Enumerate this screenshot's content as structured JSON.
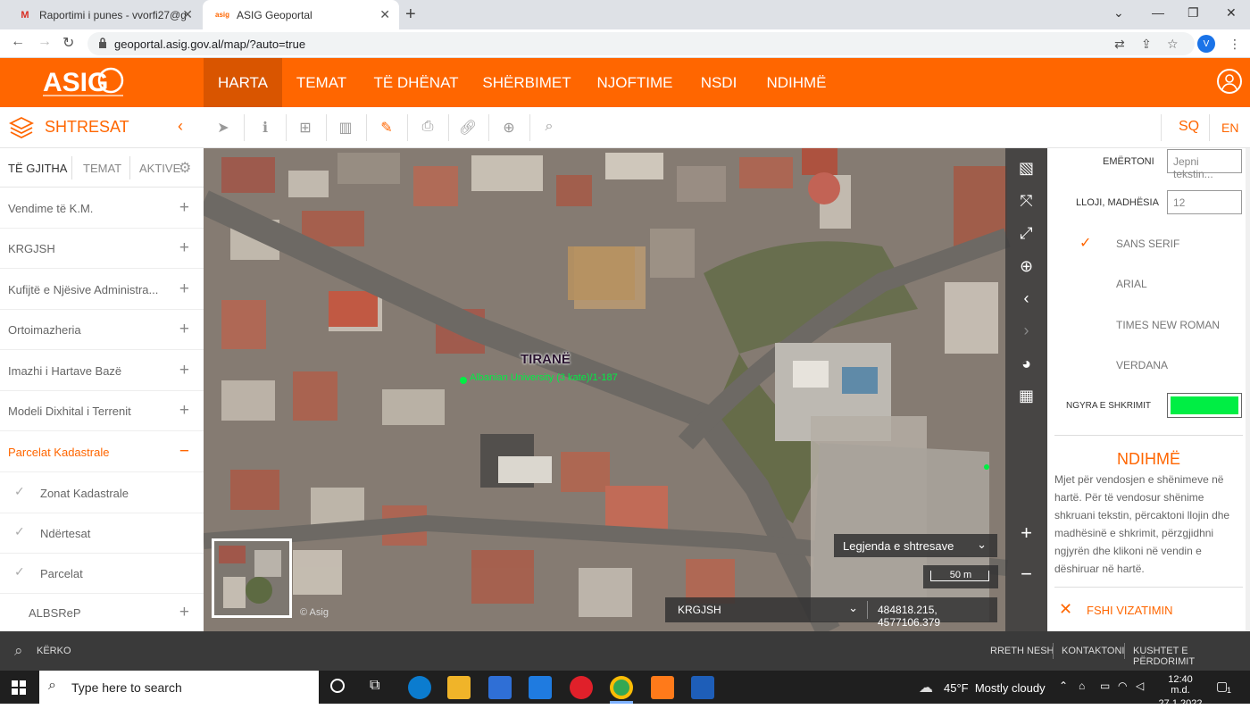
{
  "browser": {
    "tabs": [
      {
        "title": "Raportimi i punes - vvorfi27@gm",
        "icon": "gmail-icon"
      },
      {
        "title": "ASIG Geoportal",
        "icon": "asig-favicon-icon"
      }
    ],
    "url": "geoportal.asig.gov.al/map/?auto=true",
    "profile_initial": "V"
  },
  "header": {
    "logo": "ASIG",
    "menu": [
      "HARTA",
      "TEMAT",
      "TË DHËNAT",
      "SHËRBIMET",
      "NJOFTIME",
      "NSDI",
      "NDIHMË"
    ],
    "active": "HARTA"
  },
  "toolbar": {
    "panel_title": "SHTRESAT",
    "lang": {
      "sq": "SQ",
      "en": "EN"
    }
  },
  "sidebar": {
    "tabs": [
      "TË GJITHA",
      "TEMAT",
      "AKTIVE"
    ],
    "layers": [
      "Vendime të K.M.",
      "KRGJSH",
      "Kufijtë e Njësive Administra...",
      "Ortoimazheria",
      "Imazhi i Hartave Bazë",
      "Modeli Dixhital i Terrenit",
      "Parcelat Kadastrale"
    ],
    "sub_layers": [
      "Zonat Kadastrale",
      "Ndërtesat",
      "Parcelat"
    ],
    "extra_layer": "ALBSReP"
  },
  "map": {
    "city_label": "TIRANË",
    "poi_label": "Albanian University (3 kate)/1-187",
    "legend_label": "Legjenda e shtresave",
    "scale_label": "50 m",
    "projection": "KRGJSH",
    "coordinates": "484818.215, 4577106.379",
    "watermark": "© Asig"
  },
  "drawing_panel": {
    "name_label": "EMËRTONI",
    "name_placeholder": "Jepni tekstin...",
    "size_label": "LLOJI, MADHËSIA",
    "size_value": "12",
    "fonts": [
      "SANS SERIF",
      "ARIAL",
      "TIMES NEW ROMAN",
      "VERDANA"
    ],
    "selected_font": "SANS SERIF",
    "color_label": "NGYRA E SHKRIMIT",
    "color_value": "#00ee44",
    "help_title": "NDIHMË",
    "help_text": "Mjet për vendosjen e shënimeve në hartë. Për të vendosur shënime shkruani tekstin, përcaktoni llojin dhe madhësinë e shkrimit, përzgjidhni ngjyrën dhe klikoni në vendin e dëshiruar në hartë.",
    "clear_label": "FSHI VIZATIMIN"
  },
  "footer": {
    "search_label": "KËRKO",
    "links": [
      "RRETH NESH",
      "KONTAKTONI",
      "KUSHTET E PËRDORIMIT"
    ]
  },
  "taskbar": {
    "search_placeholder": "Type here to search",
    "weather": "45°F  Mostly cloudy",
    "time": "12:40 m.d.",
    "date": "27.1.2022",
    "notification_count": "1"
  },
  "colors": {
    "brand": "#ff6600",
    "accent_dark": "#d95500"
  }
}
